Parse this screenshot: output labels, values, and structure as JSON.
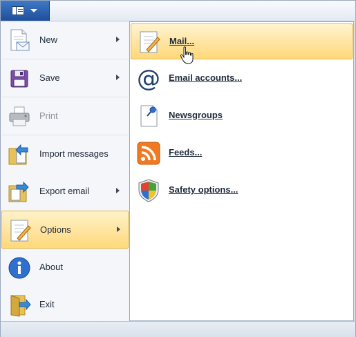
{
  "app_button": {
    "icon": "document-menu-icon",
    "caret_icon": "chevron-down-icon"
  },
  "menu": {
    "items": [
      {
        "label": "New",
        "icon": "new-message-icon",
        "has_submenu": true
      },
      {
        "label": "Save",
        "icon": "floppy-disk-icon",
        "has_submenu": true
      },
      {
        "label": "Print",
        "icon": "printer-icon",
        "has_submenu": false,
        "disabled": true
      },
      {
        "label": "Import messages",
        "icon": "import-folder-icon",
        "has_submenu": false
      },
      {
        "label": "Export email",
        "icon": "export-folder-icon",
        "has_submenu": true
      },
      {
        "label": "Options",
        "icon": "options-notepad-icon",
        "has_submenu": true,
        "selected": true
      },
      {
        "label": "About",
        "icon": "info-icon",
        "has_submenu": false
      },
      {
        "label": "Exit",
        "icon": "exit-icon",
        "has_submenu": false
      }
    ]
  },
  "submenu": {
    "items": [
      {
        "label": "Mail...",
        "icon": "mail-notepad-icon",
        "selected": true
      },
      {
        "label": "Email accounts...",
        "icon": "at-sign-icon"
      },
      {
        "label": "Newsgroups",
        "icon": "newsgroups-icon"
      },
      {
        "label": "Feeds...",
        "icon": "rss-feed-icon"
      },
      {
        "label": "Safety options...",
        "icon": "security-shield-icon"
      }
    ]
  },
  "colors": {
    "highlight": "#ffd97a",
    "highlight_border": "#e5b648",
    "app_button": "#2a5ea8",
    "text": "#1e2a3a"
  }
}
